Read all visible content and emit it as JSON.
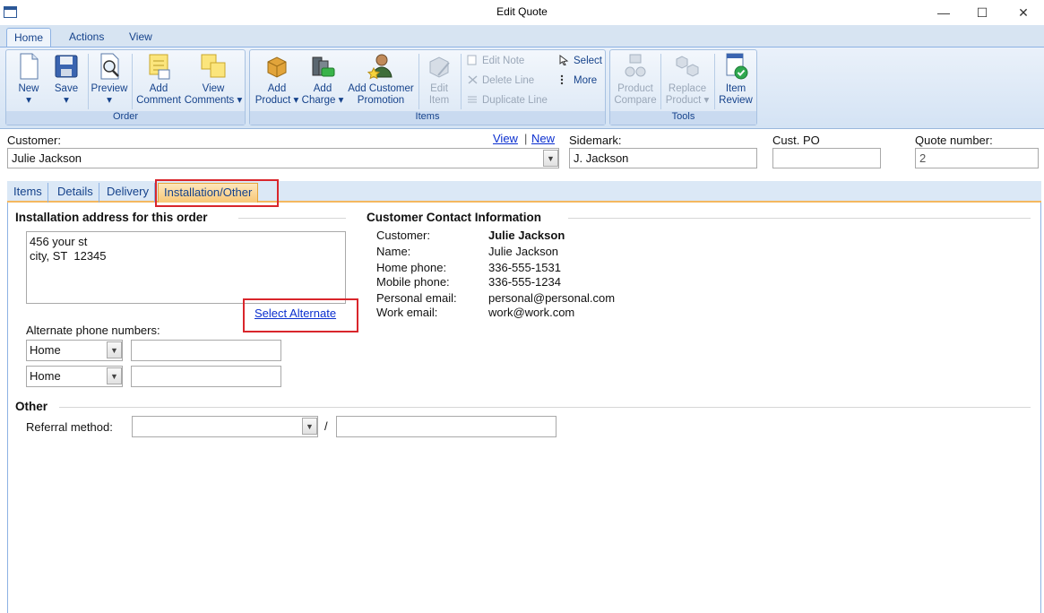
{
  "window": {
    "title": "Edit Quote",
    "minimize": "—",
    "maximize": "☐",
    "close": "✕"
  },
  "ribbon": {
    "tabs": [
      "Home",
      "Actions",
      "View"
    ],
    "groups": {
      "order": {
        "label": "Order",
        "new": [
          "New",
          "▾"
        ],
        "save": [
          "Save",
          "▾"
        ],
        "preview": [
          "Preview",
          "▾"
        ],
        "add_comment": [
          "Add",
          "Comment"
        ],
        "view_comments": [
          "View",
          "Comments ▾"
        ]
      },
      "items": {
        "label": "Items",
        "add_product": [
          "Add",
          "Product ▾"
        ],
        "add_charge": [
          "Add",
          "Charge ▾"
        ],
        "add_customer_promotion": [
          "Add Customer",
          "Promotion"
        ],
        "edit_item": [
          "Edit",
          "Item"
        ],
        "edit_note": "Edit Note",
        "delete_line": "Delete Line",
        "duplicate_line": "Duplicate Line",
        "select": "Select",
        "more": "More"
      },
      "tools": {
        "label": "Tools",
        "product_compare": [
          "Product",
          "Compare"
        ],
        "replace_product": [
          "Replace",
          "Product ▾"
        ],
        "item_review": [
          "Item",
          "Review"
        ]
      }
    }
  },
  "header": {
    "customer_label": "Customer:",
    "customer_value": "Julie Jackson",
    "view_link": "View",
    "link_sep": "|",
    "new_link": "New",
    "sidemark_label": "Sidemark:",
    "sidemark_value": "J. Jackson",
    "cust_po_label": "Cust. PO",
    "cust_po_value": "",
    "quote_number_label": "Quote number:",
    "quote_number_value": "2"
  },
  "content_tabs": [
    "Items",
    "Details",
    "Delivery",
    "Installation/Other"
  ],
  "installation": {
    "title": "Installation address for this order",
    "address": "456 your st\ncity, ST  12345",
    "select_alternate": "Select Alternate",
    "alt_phone_label": "Alternate phone numbers:",
    "phones": [
      {
        "type": "Home",
        "number": ""
      },
      {
        "type": "Home",
        "number": ""
      }
    ]
  },
  "contact": {
    "title": "Customer Contact Information",
    "rows": [
      {
        "label": "Customer:",
        "value": "Julie Jackson"
      },
      {
        "label": "Name:",
        "value": "Julie Jackson"
      },
      {
        "label": "Home phone:",
        "value": "336-555-1531"
      },
      {
        "label": "Mobile phone:",
        "value": "336-555-1234"
      },
      {
        "label": "Personal email:",
        "value": "personal@personal.com"
      },
      {
        "label": "Work email:",
        "value": "work@work.com"
      }
    ]
  },
  "other": {
    "title": "Other",
    "referral_label": "Referral method:",
    "referral_value": "",
    "separator": "/",
    "referral_detail": ""
  },
  "colors": {
    "highlight": "#d9262c",
    "ribbon_text": "#15428b",
    "link": "#0b2fcf",
    "active_tab": "#f8c877"
  }
}
